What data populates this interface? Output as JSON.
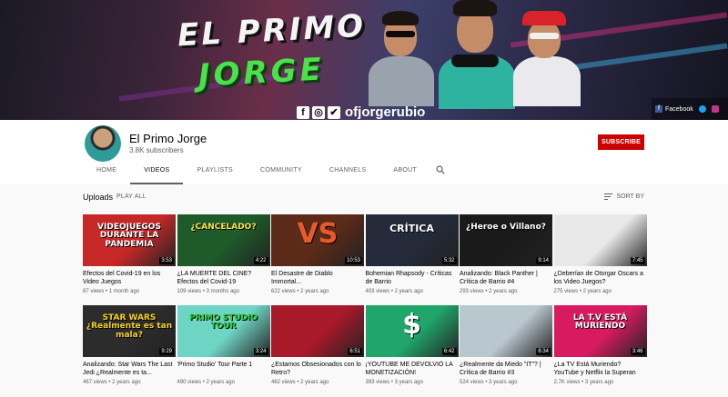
{
  "banner": {
    "title_line1": "EL PRIMO",
    "title_line2": "JORGE",
    "handle": "ofjorgerubio",
    "social_facebook_label": "Facebook",
    "icons": [
      "facebook-icon",
      "instagram-icon",
      "twitter-icon"
    ]
  },
  "channel": {
    "name": "El Primo Jorge",
    "subscribers": "3.8K subscribers",
    "subscribe_label": "SUBSCRIBE"
  },
  "tabs": [
    {
      "label": "HOME",
      "active": false
    },
    {
      "label": "VIDEOS",
      "active": true
    },
    {
      "label": "PLAYLISTS",
      "active": false
    },
    {
      "label": "COMMUNITY",
      "active": false
    },
    {
      "label": "CHANNELS",
      "active": false
    },
    {
      "label": "ABOUT",
      "active": false
    }
  ],
  "uploads": {
    "title": "Uploads",
    "play_all": "PLAY ALL",
    "sort_by": "SORT BY"
  },
  "videos": [
    {
      "title": "Efectos del Covid-19 en los Video Juegos",
      "views": "87 views",
      "age": "1 month ago",
      "duration": "3:53",
      "thumb_text": "VIDEOJUEGOS DURANTE LA PANDEMIA",
      "colors": [
        "#c62828",
        "#ffffff"
      ]
    },
    {
      "title": "¿LA MUERTE DEL CINE? Efectos del Covid-19",
      "views": "109 views",
      "age": "3 months ago",
      "duration": "4:22",
      "thumb_text": "¿CANCELADO?",
      "colors": [
        "#1e5a2a",
        "#f6e44b"
      ]
    },
    {
      "title": "El Desastre de Diablo Immortal...",
      "views": "622 views",
      "age": "2 years ago",
      "duration": "10:53",
      "thumb_text": "VS",
      "colors": [
        "#5b2a18",
        "#e85a2a"
      ]
    },
    {
      "title": "Bohemian Rhapsody - Críticas de Barrio",
      "views": "403 views",
      "age": "2 years ago",
      "duration": "5:32",
      "thumb_text": "CRÍTICA",
      "colors": [
        "#242a3a",
        "#ffffff"
      ]
    },
    {
      "title": "Analizando: Black Panther | Crítica de Barrio #4",
      "views": "293 views",
      "age": "2 years ago",
      "duration": "9:14",
      "thumb_text": "¿Heroe o Villano?",
      "colors": [
        "#1a1a1a",
        "#ffffff"
      ]
    },
    {
      "title": "¿Deberían de Otorgar Oscars a los Video Juegos?",
      "views": "275 views",
      "age": "2 years ago",
      "duration": "7:45",
      "thumb_text": "",
      "colors": [
        "#e9e9e9",
        "#b8860b"
      ]
    },
    {
      "title": "Analizando: Star Wars The Last Jedi ¿Realmente es ta...",
      "views": "467 views",
      "age": "2 years ago",
      "duration": "9:29",
      "thumb_text": "STAR WARS ¿Realmente es tan mala?",
      "colors": [
        "#2c2c2c",
        "#f6d21d"
      ]
    },
    {
      "title": "'Primo Studio' Tour Parte 1",
      "views": "490 views",
      "age": "2 years ago",
      "duration": "3:24",
      "thumb_text": "PRIMO STUDIO TOUR",
      "colors": [
        "#6ed4c4",
        "#2ecc40"
      ]
    },
    {
      "title": "¿Estamos Obsesionados con lo Retro?",
      "views": "462 views",
      "age": "2 years ago",
      "duration": "6:51",
      "thumb_text": "",
      "colors": [
        "#a8192a",
        "#ff3b3b"
      ]
    },
    {
      "title": "¡YOUTUBE ME DEVOLVIÓ LA MONETIZACIÓN!",
      "views": "393 views",
      "age": "3 years ago",
      "duration": "6:42",
      "thumb_text": "$",
      "colors": [
        "#20a56b",
        "#ffffff"
      ]
    },
    {
      "title": "¿Realmente da Miedo \"IT\"? | Crítica de Barrio #3",
      "views": "524 views",
      "age": "3 years ago",
      "duration": "6:34",
      "thumb_text": "",
      "colors": [
        "#b9c7cf",
        "#c62828"
      ]
    },
    {
      "title": "¿La TV Está Muriendo? YouTube y Netflix la Superan",
      "views": "2.7K views",
      "age": "3 years ago",
      "duration": "3:46",
      "thumb_text": "LA T.V ESTÁ MURIENDO",
      "colors": [
        "#d81b60",
        "#ffffff"
      ]
    }
  ]
}
